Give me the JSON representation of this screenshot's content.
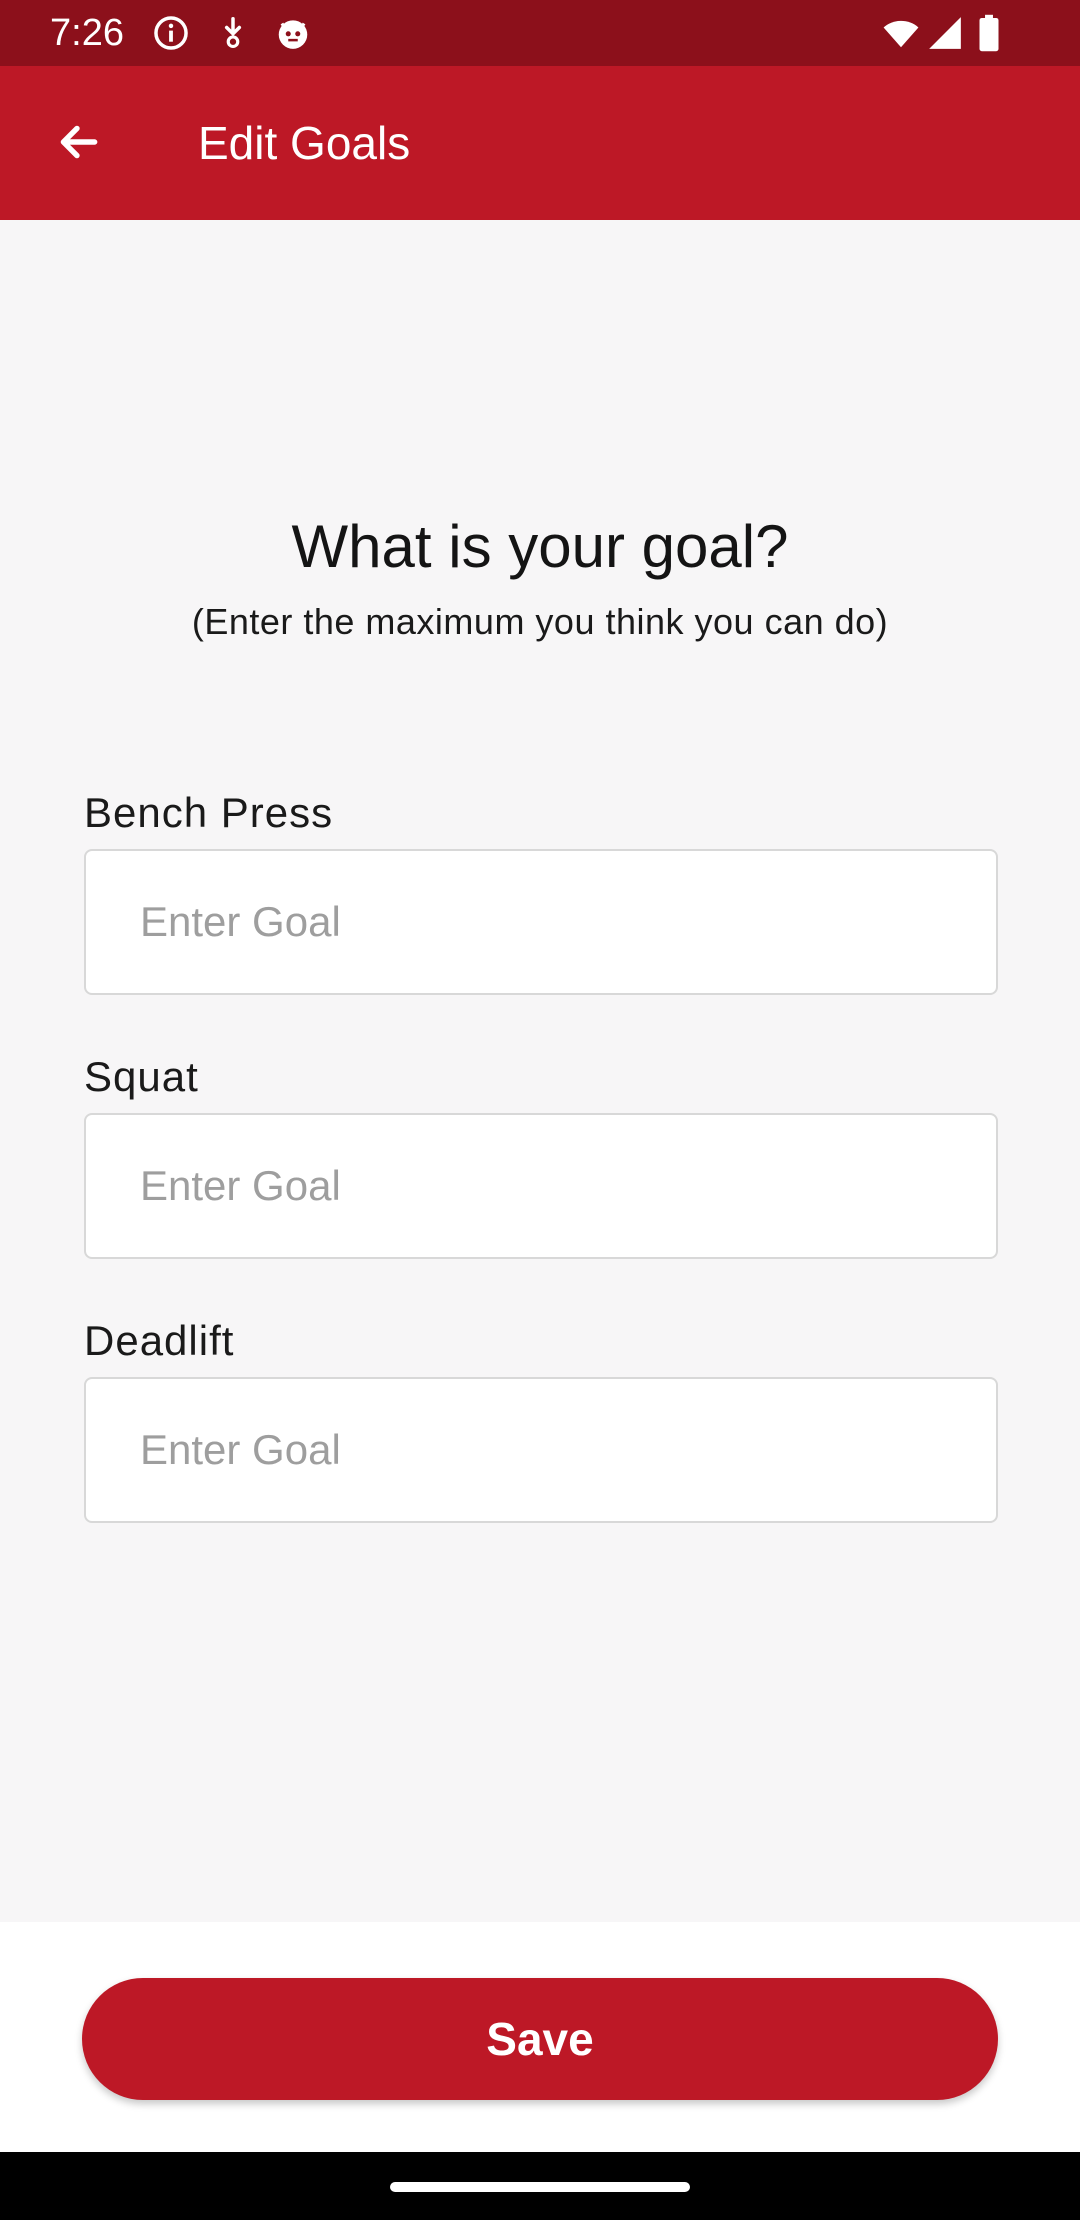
{
  "status_bar": {
    "time": "7:26",
    "left_icons": [
      "info-icon",
      "download-icon",
      "face-icon"
    ],
    "right_icons": [
      "wifi-icon",
      "signal-icon",
      "battery-icon"
    ]
  },
  "app_bar": {
    "title": "Edit Goals",
    "back_icon": "arrow-left-icon"
  },
  "main": {
    "question": "What is your goal?",
    "hint": "(Enter the maximum you think you can do)",
    "fields": [
      {
        "label": "Bench Press",
        "value": "",
        "placeholder": "Enter Goal"
      },
      {
        "label": "Squat",
        "value": "",
        "placeholder": "Enter Goal"
      },
      {
        "label": "Deadlift",
        "value": "",
        "placeholder": "Enter Goal"
      }
    ]
  },
  "footer": {
    "save_label": "Save"
  },
  "colors": {
    "status_bar": "#8c101b",
    "primary": "#bd1826",
    "background": "#f7f6f7",
    "input_border": "#d8d8d8",
    "placeholder": "#9e9e9e"
  }
}
